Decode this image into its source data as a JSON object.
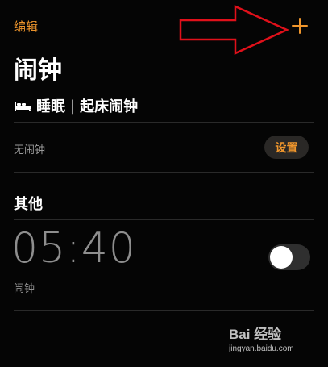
{
  "header": {
    "edit_label": "编辑",
    "add_label": "+"
  },
  "page": {
    "title": "闹钟"
  },
  "sleep": {
    "icon": "bed-icon",
    "label": "睡眠",
    "separator": "|",
    "sublabel": "起床闹钟",
    "no_alarm_text": "无闹钟",
    "setup_label": "设置"
  },
  "other": {
    "section_title": "其他",
    "alarms": [
      {
        "time": "05:40",
        "label": "闹钟",
        "enabled": false
      }
    ]
  },
  "watermark": {
    "brand": "Bai  经验",
    "url": "jingyan.baidu.com"
  },
  "colors": {
    "accent": "#f0962c",
    "background": "#050505",
    "divider": "#2a2a2a",
    "annotation_arrow": "#e0101a"
  }
}
